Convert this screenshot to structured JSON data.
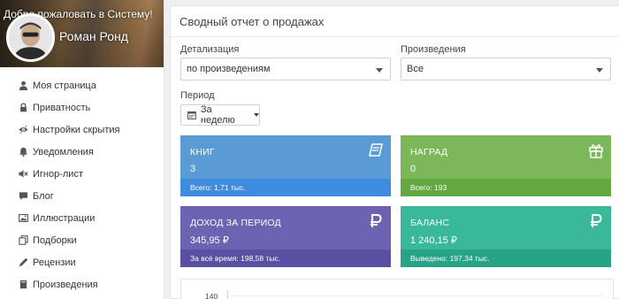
{
  "profile": {
    "welcome": "Добро пожаловать в Систему!",
    "name": "Роман Ронд"
  },
  "sidebar": {
    "items": [
      {
        "label": "Моя страница",
        "icon": "user-icon"
      },
      {
        "label": "Приватность",
        "icon": "lock-icon"
      },
      {
        "label": "Настройки скрытия",
        "icon": "eye-slash-icon"
      },
      {
        "label": "Уведомления",
        "icon": "bell-icon"
      },
      {
        "label": "Игнор-лист",
        "icon": "mute-icon"
      },
      {
        "label": "Блог",
        "icon": "comment-icon"
      },
      {
        "label": "Иллюстрации",
        "icon": "image-icon"
      },
      {
        "label": "Подборки",
        "icon": "copy-icon"
      },
      {
        "label": "Рецензии",
        "icon": "pen-icon"
      },
      {
        "label": "Произведения",
        "icon": "book-icon"
      }
    ]
  },
  "report": {
    "title": "Сводный отчет о продажах",
    "detail_label": "Детализация",
    "detail_value": "по произведениям",
    "works_label": "Произведения",
    "works_value": "Все",
    "period_label": "Период",
    "period_value": "За неделю"
  },
  "cards": {
    "books": {
      "title": "КНИГ",
      "value": "3",
      "footer": "Всего: 1,71 тыс.",
      "color": "#5b9bd5",
      "footer_color": "#3d8ce0",
      "icon": "book-icon"
    },
    "awards": {
      "title": "НАГРАД",
      "value": "0",
      "footer": "Всего: 193",
      "color": "#7cb85a",
      "footer_color": "#63a841",
      "icon": "gift-icon"
    },
    "income": {
      "title": "ДОХОД ЗА ПЕРИОД",
      "value": "345,95 ₽",
      "footer": "За всё время: 198,58 тыс.",
      "color": "#6c63b3",
      "footer_color": "#5a50a3",
      "icon": "ruble-icon"
    },
    "balance": {
      "title": "БАЛАНС",
      "value": "1 240,15 ₽",
      "footer": "Выведено: 197,34 тыс.",
      "color": "#3ab89a",
      "footer_color": "#27a385",
      "icon": "ruble-icon"
    }
  },
  "chart": {
    "y_top_tick": "140"
  }
}
